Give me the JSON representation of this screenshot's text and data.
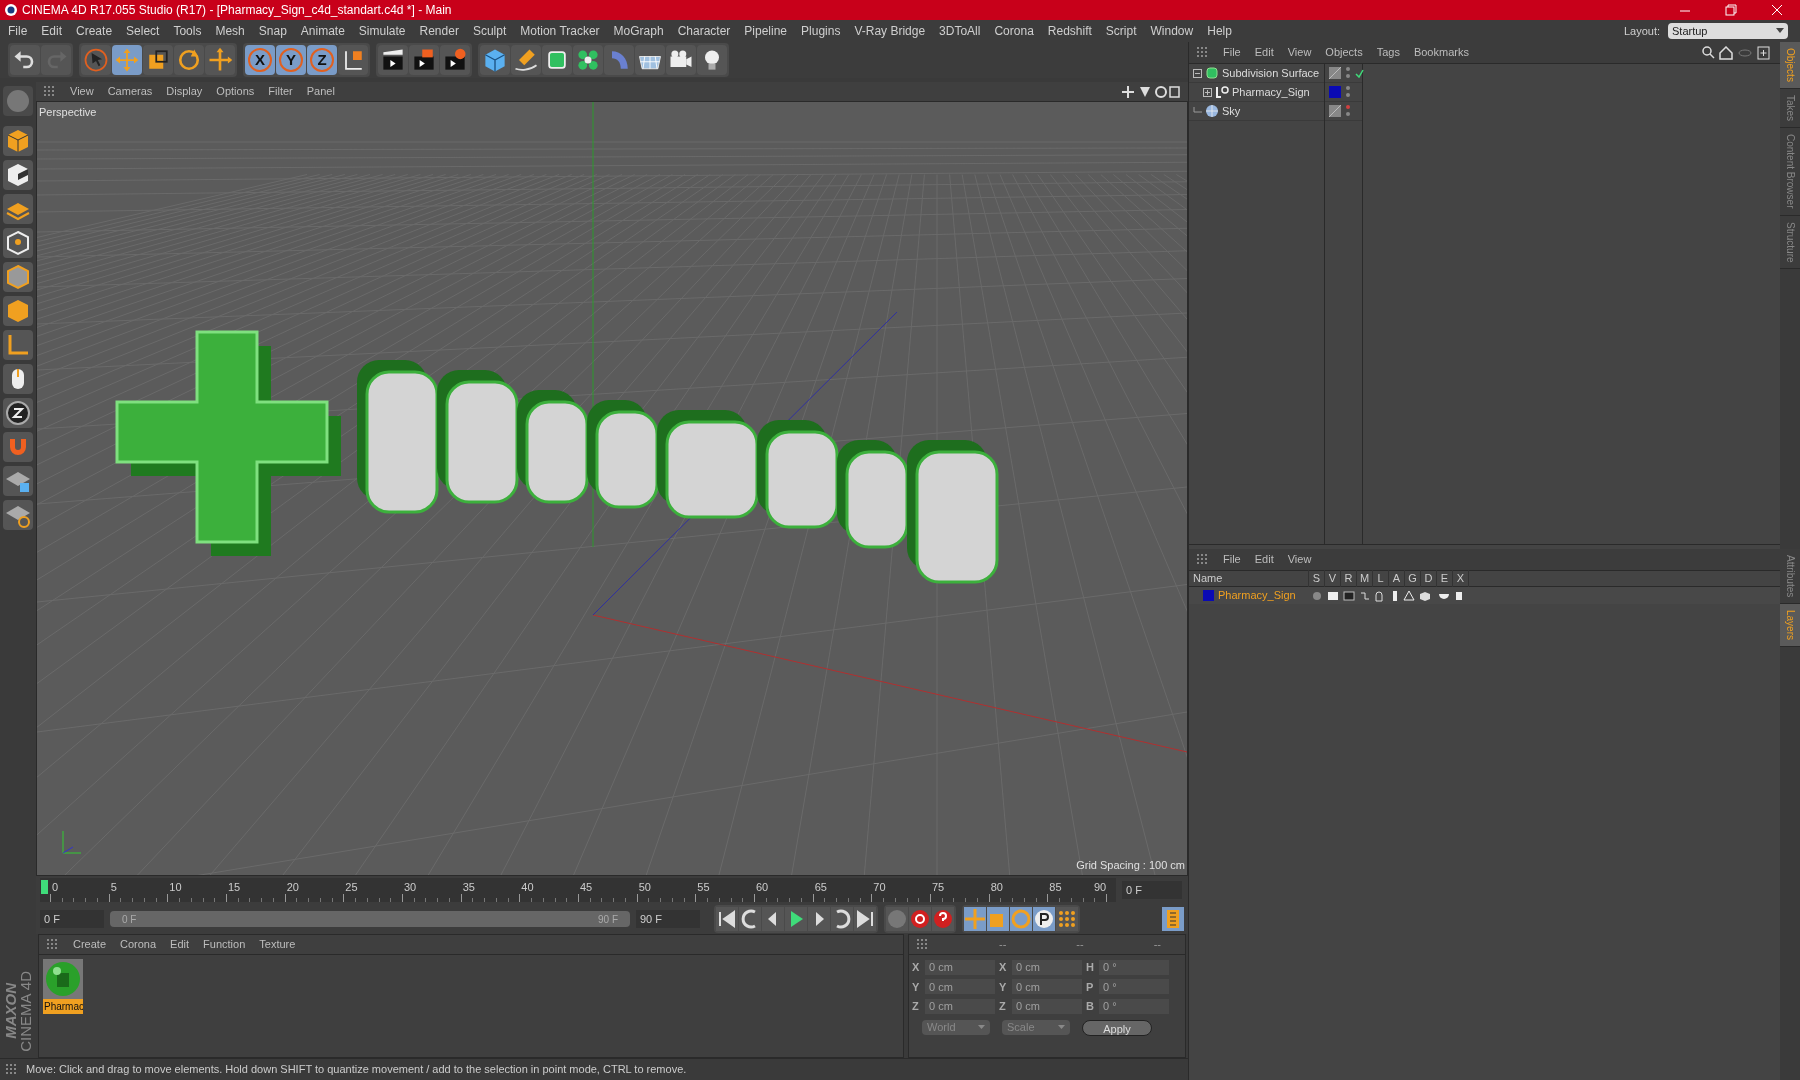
{
  "window": {
    "title": "CINEMA 4D R17.055 Studio (R17) - [Pharmacy_Sign_c4d_standart.c4d *] - Main"
  },
  "menu": [
    "File",
    "Edit",
    "Create",
    "Select",
    "Tools",
    "Mesh",
    "Snap",
    "Animate",
    "Simulate",
    "Render",
    "Sculpt",
    "Motion Tracker",
    "MoGraph",
    "Character",
    "Pipeline",
    "Plugins",
    "V-Ray Bridge",
    "3DToAll",
    "Corona",
    "Redshift",
    "Script",
    "Window",
    "Help"
  ],
  "layout": {
    "label": "Layout:",
    "value": "Startup"
  },
  "axis_buttons": [
    {
      "label": "X",
      "selected": true
    },
    {
      "label": "Y",
      "selected": true
    },
    {
      "label": "Z",
      "selected": true
    }
  ],
  "viewport": {
    "menu": [
      "View",
      "Cameras",
      "Display",
      "Options",
      "Filter",
      "Panel"
    ],
    "camera": "Perspective",
    "grid_spacing": "Grid Spacing : 100 cm"
  },
  "timeline": {
    "ticks": [
      "0",
      "5",
      "10",
      "15",
      "20",
      "25",
      "30",
      "35",
      "40",
      "45",
      "50",
      "55",
      "60",
      "65",
      "70",
      "75",
      "80",
      "85",
      "90"
    ],
    "current_frame": "0 F",
    "start": "0 F",
    "range_start": "0 F",
    "range_end": "90 F",
    "end": "90 F"
  },
  "material_manager": {
    "menu": [
      "Create",
      "Corona",
      "Edit",
      "Function",
      "Texture"
    ],
    "materials": [
      {
        "name": "Pharmac",
        "selected": true
      }
    ]
  },
  "coordinates": {
    "headers": [
      "--",
      "--",
      "--"
    ],
    "rows": [
      {
        "cells": [
          {
            "label": "X",
            "value": "0 cm"
          },
          {
            "label": "X",
            "value": "0 cm"
          },
          {
            "label": "H",
            "value": "0 °"
          }
        ]
      },
      {
        "cells": [
          {
            "label": "Y",
            "value": "0 cm"
          },
          {
            "label": "Y",
            "value": "0 cm"
          },
          {
            "label": "P",
            "value": "0 °"
          }
        ]
      },
      {
        "cells": [
          {
            "label": "Z",
            "value": "0 cm"
          },
          {
            "label": "Z",
            "value": "0 cm"
          },
          {
            "label": "B",
            "value": "0 °"
          }
        ]
      }
    ],
    "dropdowns": [
      "World",
      "Scale"
    ],
    "apply": "Apply"
  },
  "logo": [
    "MAXON",
    "CINEMA 4D"
  ],
  "status": "Move: Click and drag to move elements. Hold down SHIFT to quantize movement / add to the selection in point mode, CTRL to remove.",
  "object_manager": {
    "menu": [
      "File",
      "Edit",
      "View",
      "Objects",
      "Tags",
      "Bookmarks"
    ],
    "objects": [
      {
        "name": "Subdivision Surface",
        "kind": "subdivision",
        "expanded": true,
        "children": [
          {
            "name": "Pharmacy_Sign",
            "kind": "null",
            "expanded": false,
            "color": "#0a0ab4"
          }
        ]
      },
      {
        "name": "Sky",
        "kind": "sky"
      }
    ]
  },
  "layer_manager": {
    "menu": [
      "File",
      "Edit",
      "View"
    ],
    "columns": [
      "Name",
      "S",
      "V",
      "R",
      "M",
      "L",
      "A",
      "G",
      "D",
      "E",
      "X"
    ],
    "layers": [
      {
        "name": "Pharmacy_Sign",
        "color": "#0a0ab4",
        "selected": true
      }
    ]
  },
  "side_tabs": [
    {
      "label": "Objects",
      "selected": true
    },
    {
      "label": "Takes",
      "selected": false
    },
    {
      "label": "Content Browser",
      "selected": false
    },
    {
      "label": "Structure",
      "selected": false
    }
  ],
  "side_tabs_lower": [
    {
      "label": "Attributes",
      "selected": false
    },
    {
      "label": "Layers",
      "selected": true
    }
  ]
}
